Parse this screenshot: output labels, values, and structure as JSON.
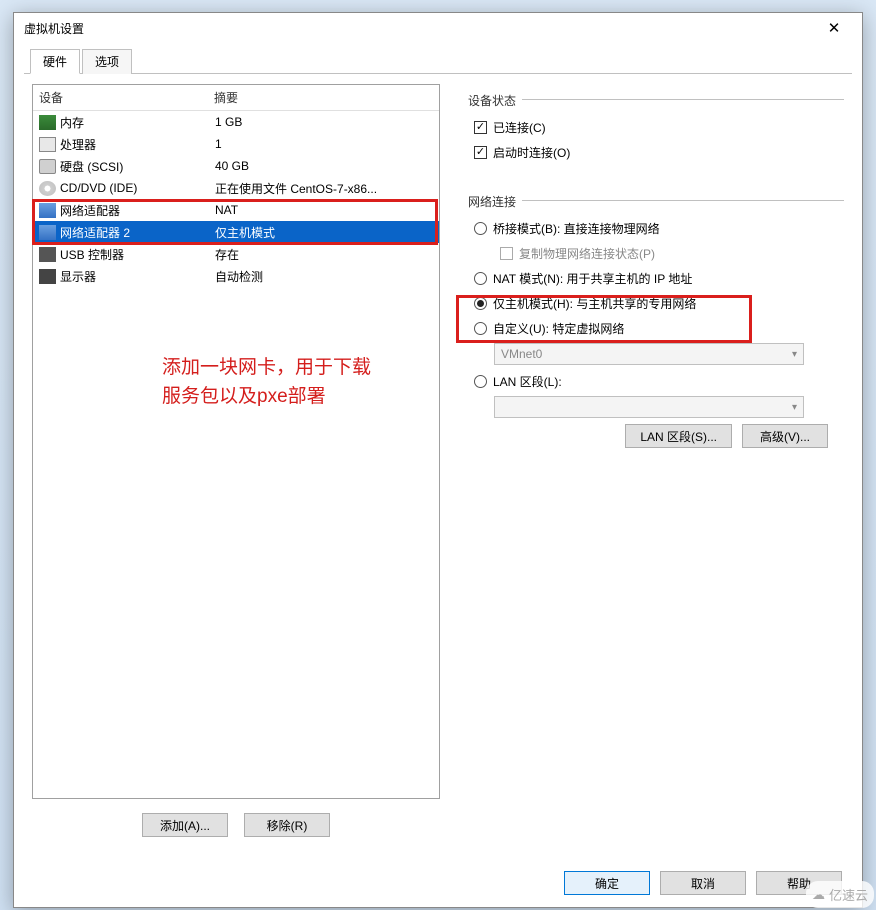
{
  "window": {
    "title": "虚拟机设置"
  },
  "tabs": {
    "hardware": "硬件",
    "options": "选项"
  },
  "headers": {
    "device": "设备",
    "summary": "摘要"
  },
  "devices": [
    {
      "name": "内存",
      "summary": "1 GB",
      "icon": "memory"
    },
    {
      "name": "处理器",
      "summary": "1",
      "icon": "cpu"
    },
    {
      "name": "硬盘 (SCSI)",
      "summary": "40 GB",
      "icon": "disk"
    },
    {
      "name": "CD/DVD (IDE)",
      "summary": "正在使用文件 CentOS-7-x86...",
      "icon": "cd"
    },
    {
      "name": "网络适配器",
      "summary": "NAT",
      "icon": "net"
    },
    {
      "name": "网络适配器 2",
      "summary": "仅主机模式",
      "icon": "net",
      "selected": true
    },
    {
      "name": "USB 控制器",
      "summary": "存在",
      "icon": "usb"
    },
    {
      "name": "显示器",
      "summary": "自动检测",
      "icon": "display"
    }
  ],
  "annotation": {
    "line1": "添加一块网卡，用于下载",
    "line2": "服务包以及pxe部署"
  },
  "buttons": {
    "add": "添加(A)...",
    "remove": "移除(R)",
    "lan_segment": "LAN 区段(S)...",
    "advanced": "高级(V)...",
    "ok": "确定",
    "cancel": "取消",
    "help": "帮助"
  },
  "status": {
    "title": "设备状态",
    "connected": "已连接(C)",
    "connect_at_poweron": "启动时连接(O)"
  },
  "network": {
    "title": "网络连接",
    "bridged": "桥接模式(B): 直接连接物理网络",
    "replicate": "复制物理网络连接状态(P)",
    "nat": "NAT 模式(N): 用于共享主机的 IP 地址",
    "hostonly": "仅主机模式(H): 与主机共享的专用网络",
    "custom": "自定义(U): 特定虚拟网络",
    "vmnet": "VMnet0",
    "lan": "LAN 区段(L):"
  },
  "watermark": "亿速云"
}
